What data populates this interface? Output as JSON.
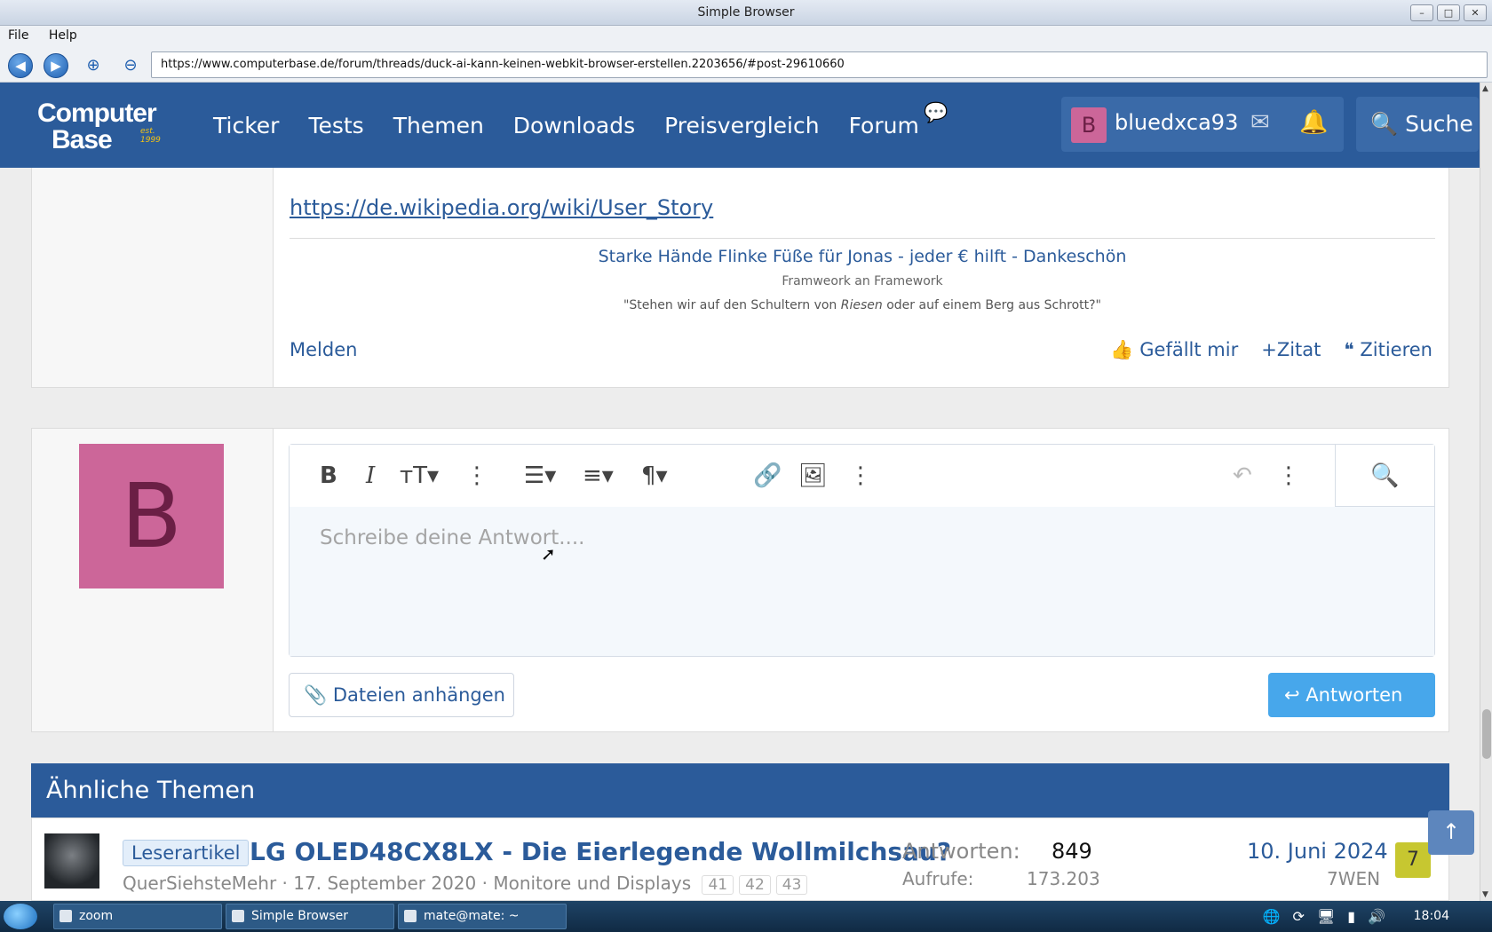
{
  "window": {
    "title": "Simple Browser",
    "minimize": "–",
    "maximize": "□",
    "close": "✕"
  },
  "menu": {
    "file": "File",
    "help": "Help"
  },
  "toolbar": {
    "url": "https://www.computerbase.de/forum/threads/duck-ai-kann-keinen-webkit-browser-erstellen.2203656/#post-29610660"
  },
  "site": {
    "logo_line1": "Computer",
    "logo_line2": "Base",
    "logo_est": "est. 1999",
    "nav": [
      "Ticker",
      "Tests",
      "Themen",
      "Downloads",
      "Preisvergleich",
      "Forum"
    ],
    "user_initial": "B",
    "username": "bluedxca93",
    "search_label": "Suche"
  },
  "post": {
    "link": "https://de.wikipedia.org/wiki/User_Story",
    "signature_line1": "Starke Hände Flinke Füße für Jonas - jeder € hilft - Dankeschön",
    "signature_line2": "Framweork an Framework",
    "signature_line3_before": "\"Stehen wir auf den Schultern von ",
    "signature_line3_em": "Riesen",
    "signature_line3_after": " oder auf einem Berg aus Schrott?\"",
    "report": "Melden",
    "like": "Gefällt mir",
    "quote_plus": "Zitat",
    "quote": "Zitieren"
  },
  "reply": {
    "avatar_initial": "B",
    "placeholder": "Schreibe deine Antwort....",
    "attach": "Dateien anhängen",
    "submit": "Antworten"
  },
  "similar": {
    "heading": "Ähnliche Themen",
    "threads": [
      {
        "prefix": "Leserartikel",
        "title": "LG OLED48CX8LX - Die Eierlegende Wollmilchsau?",
        "author": "QuerSiehsteMehr",
        "date": "17. September 2020",
        "forum": "Monitore und Displays",
        "pages": [
          "41",
          "42",
          "43"
        ],
        "replies_label": "Antworten:",
        "replies": "849",
        "views_label": "Aufrufe:",
        "views": "173.203",
        "last_date": "10. Juni 2024",
        "last_user": "7WEN",
        "last_user_initial": "7"
      }
    ]
  },
  "taskbar": {
    "tasks": [
      "zoom",
      "Simple Browser",
      "mate@mate: ~"
    ],
    "clock": "18:04"
  }
}
